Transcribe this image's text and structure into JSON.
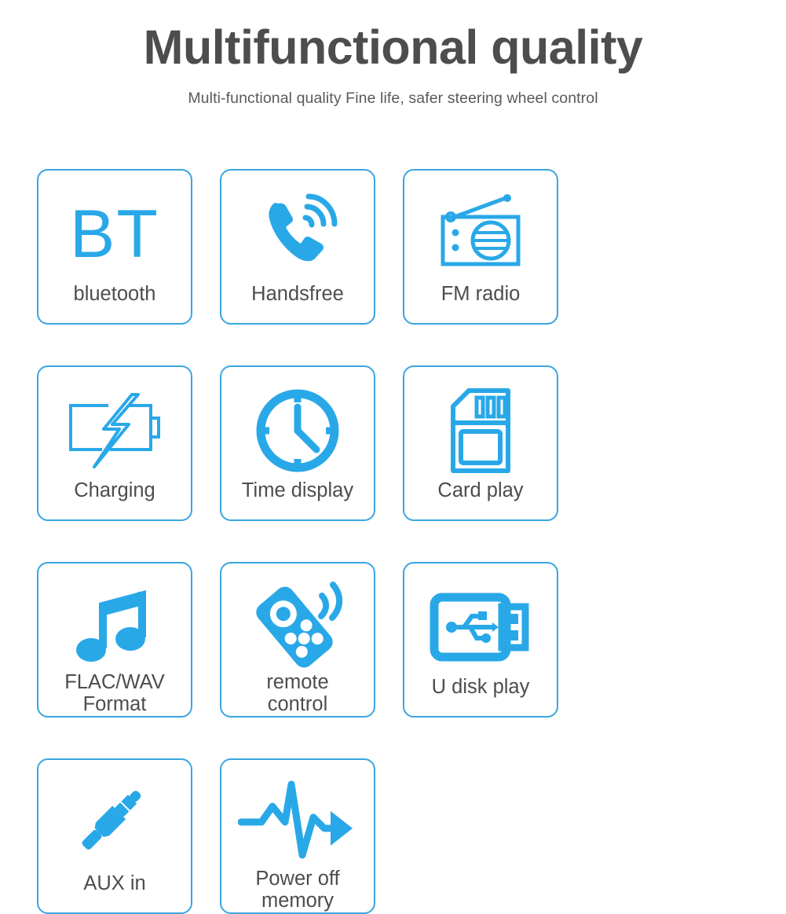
{
  "header": {
    "title": "Multifunctional quality",
    "subtitle": "Multi-functional quality Fine life, safer steering wheel control"
  },
  "colors": {
    "accent_blue": "#29a8e8",
    "border_blue": "#3aa6e0",
    "title_gray": "#4d4d4d",
    "label_gray": "#4d4d4d",
    "background": "#ffffff"
  },
  "features": [
    {
      "label": "bluetooth",
      "icon": "bt-text-icon",
      "icon_text": "BT"
    },
    {
      "label": "Handsfree",
      "icon": "phone-handset-icon",
      "icon_text": ""
    },
    {
      "label": "FM radio",
      "icon": "radio-icon",
      "icon_text": ""
    },
    {
      "label": "Charging",
      "icon": "battery-bolt-icon",
      "icon_text": ""
    },
    {
      "label": "Time display",
      "icon": "clock-icon",
      "icon_text": ""
    },
    {
      "label": "Card play",
      "icon": "sd-card-icon",
      "icon_text": ""
    },
    {
      "label": "FLAC/WAV\nFormat",
      "icon": "music-note-icon",
      "icon_text": ""
    },
    {
      "label": "remote\ncontrol",
      "icon": "remote-control-icon",
      "icon_text": ""
    },
    {
      "label": "U disk play",
      "icon": "usb-drive-icon",
      "icon_text": ""
    },
    {
      "label": "AUX in",
      "icon": "audio-jack-icon",
      "icon_text": ""
    },
    {
      "label": "Power off\nmemory",
      "icon": "pulse-arrow-icon",
      "icon_text": ""
    }
  ]
}
